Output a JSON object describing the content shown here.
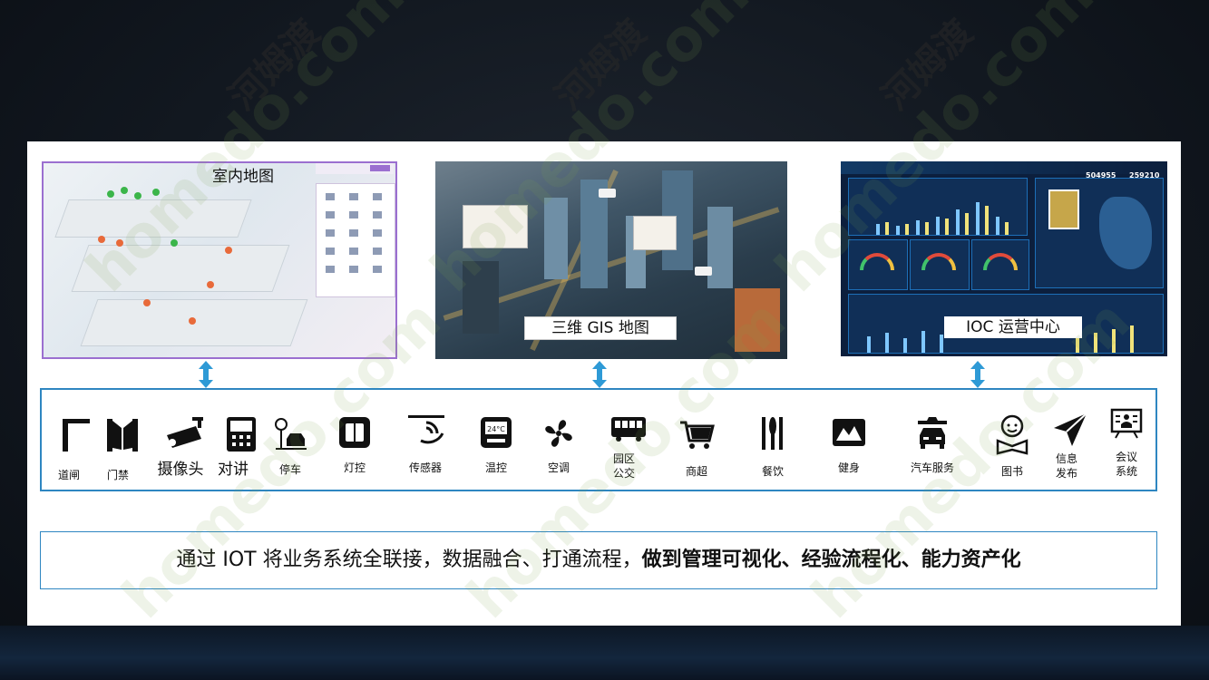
{
  "thumbnails": {
    "indoor_map": {
      "caption": "室内地图"
    },
    "gis_map": {
      "caption": "三维 GIS 地图"
    },
    "ioc": {
      "caption": "IOC 运营中心",
      "kpi_1": "504955",
      "kpi_2": "259210"
    }
  },
  "icons": [
    {
      "name": "gate-icon",
      "label": "道闸"
    },
    {
      "name": "door-access-icon",
      "label": "门禁"
    },
    {
      "name": "camera-icon",
      "label": "摄像头"
    },
    {
      "name": "intercom-icon",
      "label": "对讲"
    },
    {
      "name": "parking-icon",
      "label": "停车"
    },
    {
      "name": "light-switch-icon",
      "label": "灯控"
    },
    {
      "name": "sensor-icon",
      "label": "传感器"
    },
    {
      "name": "thermostat-icon",
      "label": "温控",
      "display": "24°C"
    },
    {
      "name": "fan-icon",
      "label": "空调"
    },
    {
      "name": "bus-icon",
      "label": "园区\n公交"
    },
    {
      "name": "cart-icon",
      "label": "商超"
    },
    {
      "name": "dining-icon",
      "label": "餐饮"
    },
    {
      "name": "fitness-icon",
      "label": "健身"
    },
    {
      "name": "car-service-icon",
      "label": "汽车服务"
    },
    {
      "name": "library-icon",
      "label": "图书"
    },
    {
      "name": "publish-icon",
      "label": "信息\n发布"
    },
    {
      "name": "meeting-icon",
      "label": "会议\n系统"
    }
  ],
  "message": {
    "normal": "通过 IOT 将业务系统全联接，数据融合、打通流程，",
    "bold": "做到管理可视化、经验流程化、能力资产化"
  },
  "watermarks": [
    "河姆渡",
    "homedo.com"
  ],
  "colors": {
    "accent": "#2e86c1",
    "map_border": "#9b6fd0",
    "arrow": "#2e9ad6"
  }
}
